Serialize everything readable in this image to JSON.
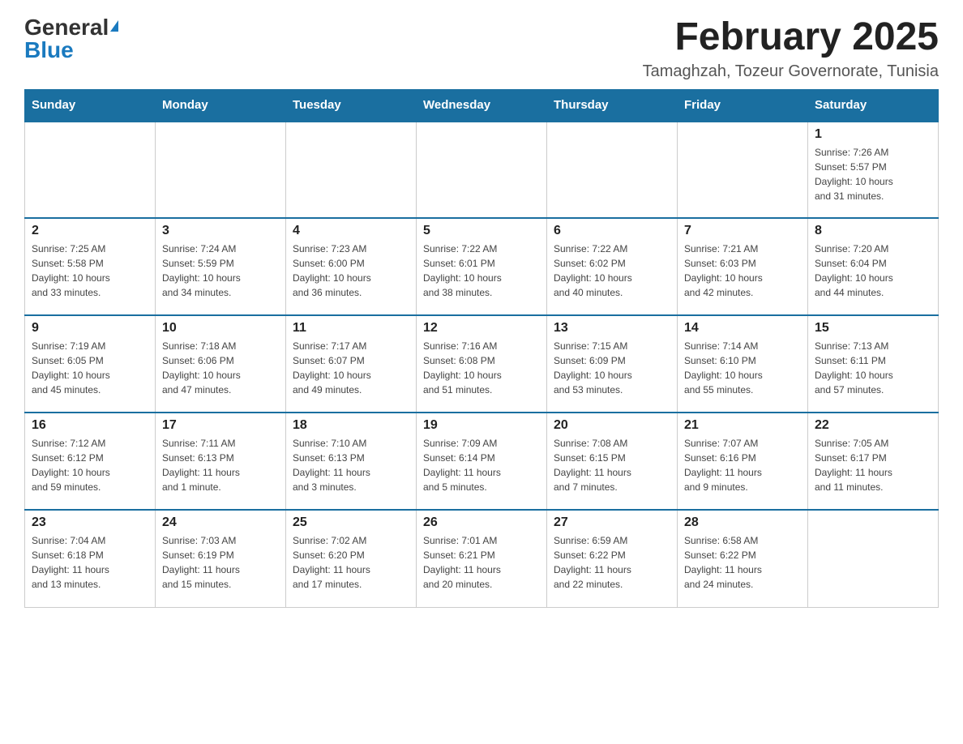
{
  "header": {
    "logo": {
      "general": "General",
      "blue": "Blue"
    },
    "title": "February 2025",
    "location": "Tamaghzah, Tozeur Governorate, Tunisia"
  },
  "weekdays": [
    "Sunday",
    "Monday",
    "Tuesday",
    "Wednesday",
    "Thursday",
    "Friday",
    "Saturday"
  ],
  "weeks": [
    [
      {
        "day": "",
        "info": ""
      },
      {
        "day": "",
        "info": ""
      },
      {
        "day": "",
        "info": ""
      },
      {
        "day": "",
        "info": ""
      },
      {
        "day": "",
        "info": ""
      },
      {
        "day": "",
        "info": ""
      },
      {
        "day": "1",
        "info": "Sunrise: 7:26 AM\nSunset: 5:57 PM\nDaylight: 10 hours\nand 31 minutes."
      }
    ],
    [
      {
        "day": "2",
        "info": "Sunrise: 7:25 AM\nSunset: 5:58 PM\nDaylight: 10 hours\nand 33 minutes."
      },
      {
        "day": "3",
        "info": "Sunrise: 7:24 AM\nSunset: 5:59 PM\nDaylight: 10 hours\nand 34 minutes."
      },
      {
        "day": "4",
        "info": "Sunrise: 7:23 AM\nSunset: 6:00 PM\nDaylight: 10 hours\nand 36 minutes."
      },
      {
        "day": "5",
        "info": "Sunrise: 7:22 AM\nSunset: 6:01 PM\nDaylight: 10 hours\nand 38 minutes."
      },
      {
        "day": "6",
        "info": "Sunrise: 7:22 AM\nSunset: 6:02 PM\nDaylight: 10 hours\nand 40 minutes."
      },
      {
        "day": "7",
        "info": "Sunrise: 7:21 AM\nSunset: 6:03 PM\nDaylight: 10 hours\nand 42 minutes."
      },
      {
        "day": "8",
        "info": "Sunrise: 7:20 AM\nSunset: 6:04 PM\nDaylight: 10 hours\nand 44 minutes."
      }
    ],
    [
      {
        "day": "9",
        "info": "Sunrise: 7:19 AM\nSunset: 6:05 PM\nDaylight: 10 hours\nand 45 minutes."
      },
      {
        "day": "10",
        "info": "Sunrise: 7:18 AM\nSunset: 6:06 PM\nDaylight: 10 hours\nand 47 minutes."
      },
      {
        "day": "11",
        "info": "Sunrise: 7:17 AM\nSunset: 6:07 PM\nDaylight: 10 hours\nand 49 minutes."
      },
      {
        "day": "12",
        "info": "Sunrise: 7:16 AM\nSunset: 6:08 PM\nDaylight: 10 hours\nand 51 minutes."
      },
      {
        "day": "13",
        "info": "Sunrise: 7:15 AM\nSunset: 6:09 PM\nDaylight: 10 hours\nand 53 minutes."
      },
      {
        "day": "14",
        "info": "Sunrise: 7:14 AM\nSunset: 6:10 PM\nDaylight: 10 hours\nand 55 minutes."
      },
      {
        "day": "15",
        "info": "Sunrise: 7:13 AM\nSunset: 6:11 PM\nDaylight: 10 hours\nand 57 minutes."
      }
    ],
    [
      {
        "day": "16",
        "info": "Sunrise: 7:12 AM\nSunset: 6:12 PM\nDaylight: 10 hours\nand 59 minutes."
      },
      {
        "day": "17",
        "info": "Sunrise: 7:11 AM\nSunset: 6:13 PM\nDaylight: 11 hours\nand 1 minute."
      },
      {
        "day": "18",
        "info": "Sunrise: 7:10 AM\nSunset: 6:13 PM\nDaylight: 11 hours\nand 3 minutes."
      },
      {
        "day": "19",
        "info": "Sunrise: 7:09 AM\nSunset: 6:14 PM\nDaylight: 11 hours\nand 5 minutes."
      },
      {
        "day": "20",
        "info": "Sunrise: 7:08 AM\nSunset: 6:15 PM\nDaylight: 11 hours\nand 7 minutes."
      },
      {
        "day": "21",
        "info": "Sunrise: 7:07 AM\nSunset: 6:16 PM\nDaylight: 11 hours\nand 9 minutes."
      },
      {
        "day": "22",
        "info": "Sunrise: 7:05 AM\nSunset: 6:17 PM\nDaylight: 11 hours\nand 11 minutes."
      }
    ],
    [
      {
        "day": "23",
        "info": "Sunrise: 7:04 AM\nSunset: 6:18 PM\nDaylight: 11 hours\nand 13 minutes."
      },
      {
        "day": "24",
        "info": "Sunrise: 7:03 AM\nSunset: 6:19 PM\nDaylight: 11 hours\nand 15 minutes."
      },
      {
        "day": "25",
        "info": "Sunrise: 7:02 AM\nSunset: 6:20 PM\nDaylight: 11 hours\nand 17 minutes."
      },
      {
        "day": "26",
        "info": "Sunrise: 7:01 AM\nSunset: 6:21 PM\nDaylight: 11 hours\nand 20 minutes."
      },
      {
        "day": "27",
        "info": "Sunrise: 6:59 AM\nSunset: 6:22 PM\nDaylight: 11 hours\nand 22 minutes."
      },
      {
        "day": "28",
        "info": "Sunrise: 6:58 AM\nSunset: 6:22 PM\nDaylight: 11 hours\nand 24 minutes."
      },
      {
        "day": "",
        "info": ""
      }
    ]
  ]
}
